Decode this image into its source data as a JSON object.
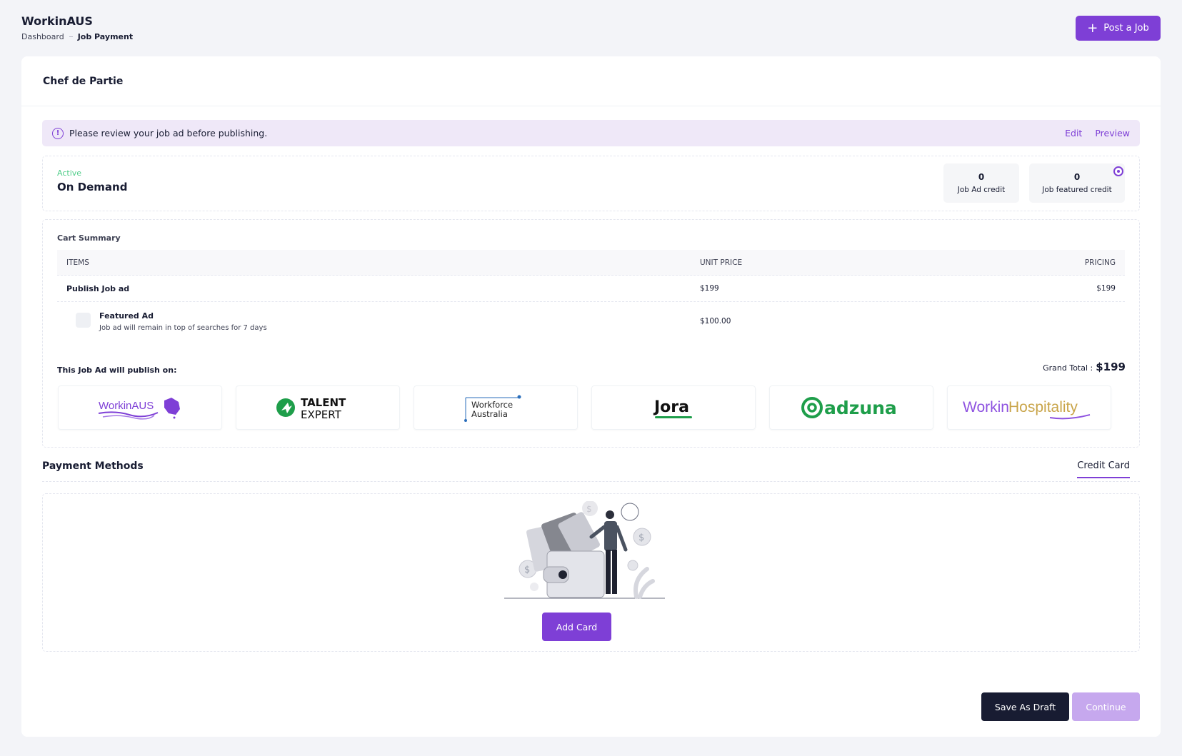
{
  "app": {
    "title": "WorkinAUS"
  },
  "breadcrumb": {
    "items": [
      "Dashboard",
      "Job Payment"
    ]
  },
  "header": {
    "post_job_label": "Post a Job",
    "post_job_icon": "plus-icon"
  },
  "job": {
    "title": "Chef de Partie"
  },
  "notice": {
    "icon": "info-icon",
    "message": "Please review your job ad before publishing.",
    "edit_label": "Edit",
    "preview_label": "Preview"
  },
  "plan": {
    "status": "Active",
    "name": "On Demand",
    "credits": [
      {
        "value": "0",
        "label": "Job Ad credit"
      },
      {
        "value": "0",
        "label": "Job featured credit"
      }
    ]
  },
  "cart": {
    "title": "Cart Summary",
    "columns": [
      "ITEMS",
      "UNIT PRICE",
      "PRICING"
    ],
    "rows": [
      {
        "item": "Publish Job ad",
        "unit_price": "$199",
        "pricing": "$199"
      },
      {
        "item": "Featured Ad",
        "description": "Job ad will remain in top of searches for 7 days",
        "unit_price": "$100.00",
        "pricing": "",
        "checked": false
      }
    ],
    "publish_on_label": "This Job Ad will publish on:",
    "grand_total_label": "Grand Total :",
    "grand_total_value": "$199",
    "partners": [
      {
        "name": "WorkinAUS",
        "icon": "workinaus-logo"
      },
      {
        "name": "TALENT EXPERT",
        "icon": "talent-expert-logo"
      },
      {
        "name": "Workforce Australia",
        "icon": "workforce-australia-logo"
      },
      {
        "name": "Jora",
        "icon": "jora-logo"
      },
      {
        "name": "adzuna",
        "icon": "adzuna-logo"
      },
      {
        "name": "WorkinHospitality",
        "icon": "workinhospitality-logo"
      }
    ]
  },
  "payment": {
    "title": "Payment Methods",
    "tab_label": "Credit Card",
    "add_card_label": "Add Card",
    "illustration": "wallet-illustration"
  },
  "footer": {
    "save_draft_label": "Save As Draft",
    "continue_label": "Continue"
  },
  "colors": {
    "accent": "#7e3fd6",
    "dark": "#181c32",
    "success": "#50cd89",
    "disabled": "#c6a8ee"
  }
}
